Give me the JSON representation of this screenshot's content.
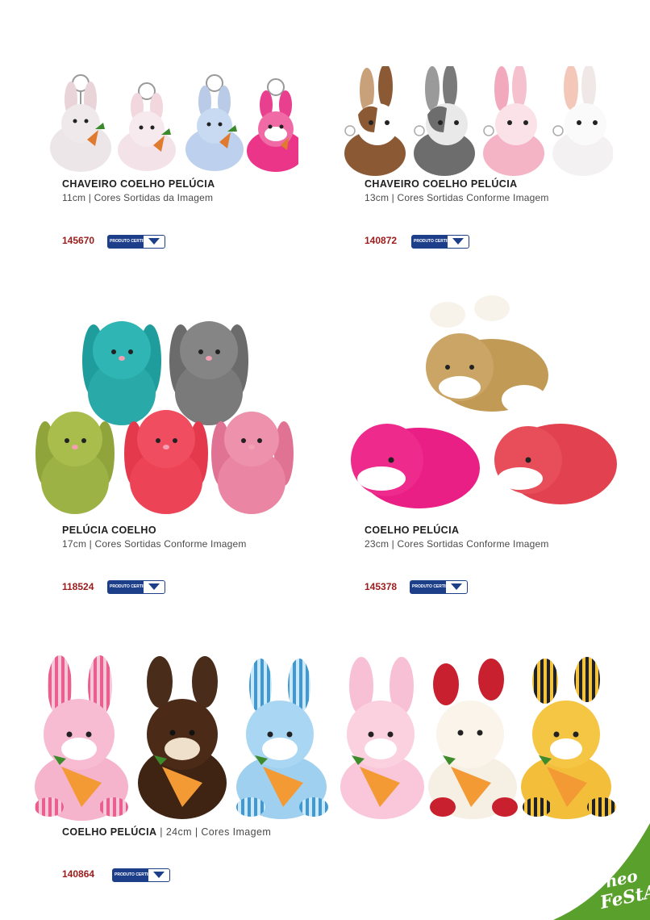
{
  "products": [
    {
      "title": "CHAVEIRO COELHO PELÚCIA",
      "desc": "11cm | Cores Sortidas da Imagem",
      "code": "145670"
    },
    {
      "title": "CHAVEIRO COELHO PELÚCIA",
      "desc": "13cm | Cores Sortidas Conforme Imagem",
      "code": "140872"
    },
    {
      "title": "PELÚCIA COELHO",
      "desc": "17cm | Cores Sortidas Conforme Imagem",
      "code": "118524"
    },
    {
      "title": "COELHO PELÚCIA",
      "desc": "23cm | Cores Sortidas Conforme Imagem",
      "code": "145378"
    },
    {
      "title": "COELHO PELÚCIA",
      "desc": " | 24cm | Cores Imagem",
      "code": "140864"
    }
  ],
  "certification": {
    "line1": "PRODUTO",
    "line2": "CERTIFICADO"
  },
  "brand": {
    "line1": "neo",
    "line2": "FeStAs!"
  },
  "colors": {
    "code": "#9b1b1b",
    "cert": "#1d3f8a",
    "brand_green": "#5aa02c"
  }
}
